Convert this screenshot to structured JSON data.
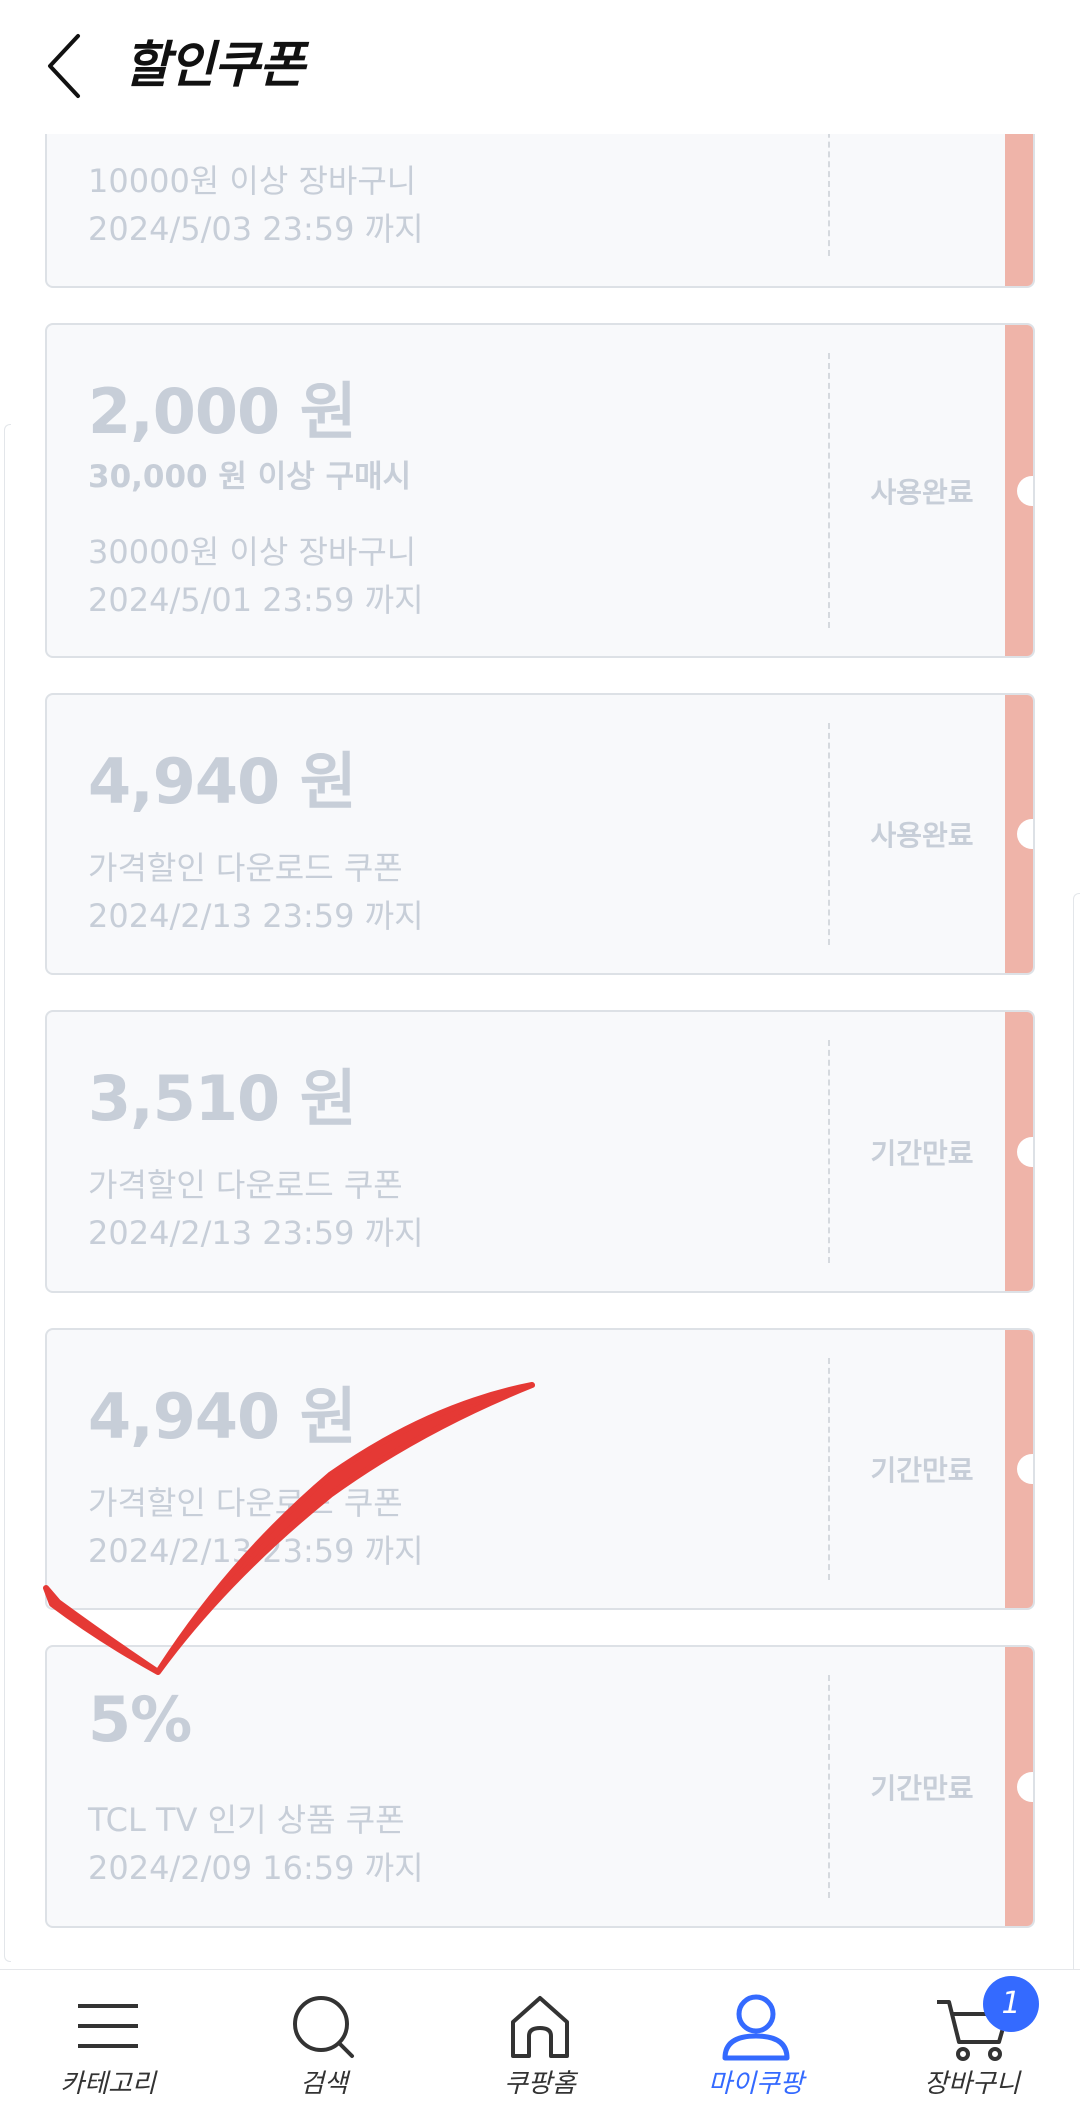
{
  "header": {
    "title": "할인쿠폰",
    "back_icon": "chevron-left-icon"
  },
  "coupons": [
    {
      "amount": "",
      "condition": "",
      "desc": "10000원 이상 장바구니",
      "expiry": "2024/5/03 23:59 까지",
      "status": ""
    },
    {
      "amount": "2,000 원",
      "condition": "30,000 원 이상 구매시",
      "desc": "30000원 이상 장바구니",
      "expiry": "2024/5/01 23:59 까지",
      "status": "사용완료"
    },
    {
      "amount": "4,940 원",
      "condition": "",
      "desc": "가격할인 다운로드 쿠폰",
      "expiry": "2024/2/13 23:59 까지",
      "status": "사용완료"
    },
    {
      "amount": "3,510 원",
      "condition": "",
      "desc": "가격할인 다운로드 쿠폰",
      "expiry": "2024/2/13 23:59 까지",
      "status": "기간만료"
    },
    {
      "amount": "4,940 원",
      "condition": "",
      "desc": "가격할인 다운로드 쿠폰",
      "expiry": "2024/2/13 23:59 까지",
      "status": "기간만료"
    },
    {
      "amount": "5%",
      "condition": "",
      "desc": "TCL TV 인기 상품 쿠폰",
      "expiry": "2024/2/09 16:59 까지",
      "status": "기간만료"
    }
  ],
  "bottom_nav": {
    "items": [
      {
        "label": "카테고리",
        "icon": "menu-icon"
      },
      {
        "label": "검색",
        "icon": "search-icon"
      },
      {
        "label": "쿠팡홈",
        "icon": "home-icon"
      },
      {
        "label": "마이쿠팡",
        "icon": "user-icon",
        "active": true
      },
      {
        "label": "장바구니",
        "icon": "cart-icon"
      }
    ],
    "cart_badge": "1"
  },
  "colors": {
    "accent": "#346aff",
    "coupon_stub": "#efb4a9",
    "faded_text": "#c7ced8",
    "checkmark": "#e53935"
  }
}
